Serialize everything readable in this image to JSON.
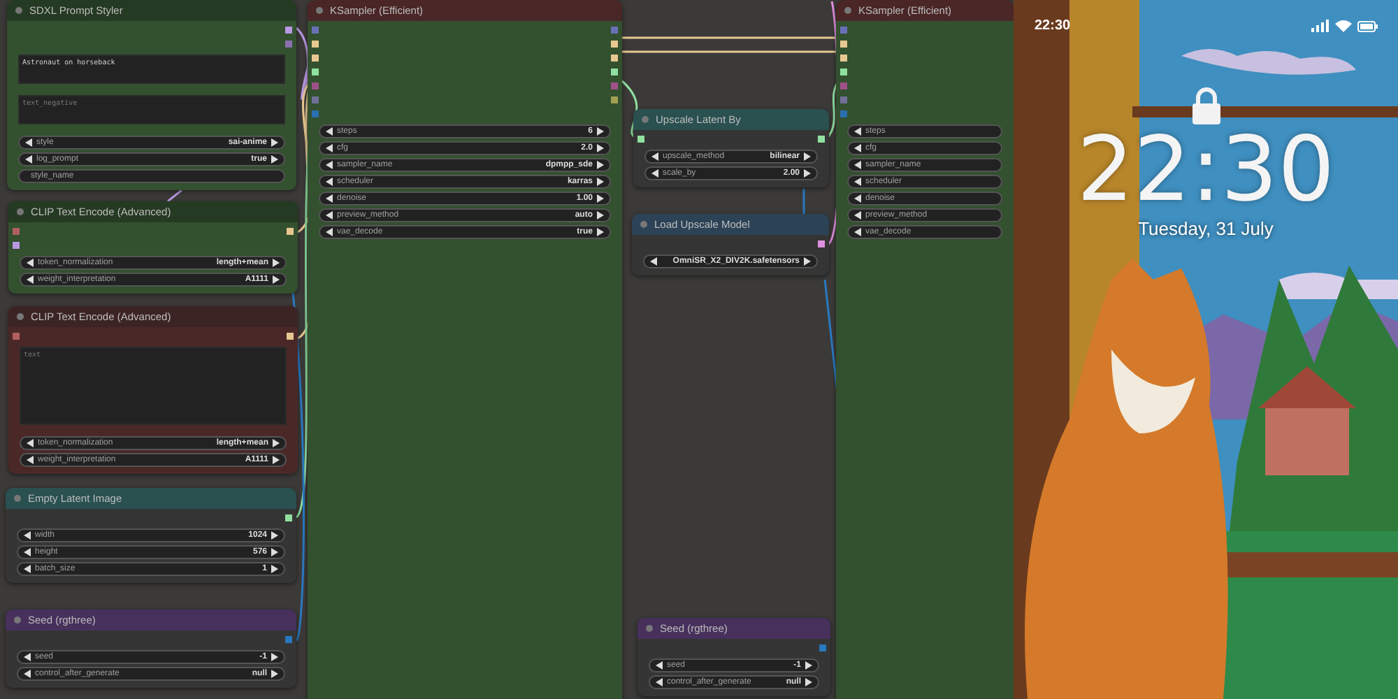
{
  "nodes": [
    {
      "title": "SDXL Prompt Styler",
      "color": "#253a22",
      "kind": "green",
      "outputs": [
        {
          "color": "#b898e0"
        },
        {
          "color": "#8a70b0"
        }
      ],
      "textareas": [
        {
          "value": "Astronaut on horseback"
        },
        {
          "placeholder": "text_negative"
        }
      ],
      "widgets": [
        {
          "kind": "combo",
          "label": "style",
          "value": "sai-anime"
        },
        {
          "kind": "combo",
          "label": "log_prompt",
          "value": "true"
        },
        {
          "kind": "text",
          "label": "style_name"
        }
      ]
    },
    {
      "title": "CLIP Text Encode (Advanced)",
      "color": "#253a22",
      "kind": "green",
      "inputs": [
        {
          "color": "#b06060"
        },
        {
          "color": "#b898e0"
        }
      ],
      "outputs": [
        {
          "color": "#e8c890"
        }
      ],
      "widgets": [
        {
          "kind": "combo",
          "label": "token_normalization",
          "value": "length+mean"
        },
        {
          "kind": "combo",
          "label": "weight_interpretation",
          "value": "A1111"
        }
      ]
    },
    {
      "title": "CLIP Text Encode (Advanced)",
      "color": "#3d2424",
      "kind": "red",
      "inputs": [
        {
          "color": "#b06060"
        }
      ],
      "outputs": [
        {
          "color": "#e8c890"
        }
      ],
      "textareas": [
        {
          "placeholder": "text"
        }
      ],
      "widgets": [
        {
          "kind": "combo",
          "label": "token_normalization",
          "value": "length+mean"
        },
        {
          "kind": "combo",
          "label": "weight_interpretation",
          "value": "A1111"
        }
      ]
    },
    {
      "title": "Empty Latent Image",
      "color": "#2a5050",
      "kind": "plain",
      "outputs": [
        {
          "color": "#90e0a0"
        }
      ],
      "widgets": [
        {
          "kind": "combo",
          "label": "width",
          "value": "1024"
        },
        {
          "kind": "combo",
          "label": "height",
          "value": "576"
        },
        {
          "kind": "combo",
          "label": "batch_size",
          "value": "1"
        }
      ]
    },
    {
      "title": "Seed (rgthree)",
      "color": "#47305c",
      "kind": "plain",
      "outputs": [
        {
          "color": "#2a78c0"
        }
      ],
      "widgets": [
        {
          "kind": "combo",
          "label": "seed",
          "value": "-1"
        },
        {
          "kind": "combo",
          "label": "control_after_generate",
          "value": "null"
        }
      ]
    },
    {
      "title": "KSampler (Efficient)",
      "color": "#4a2626",
      "kind": "green",
      "inputs": [
        {
          "color": "#6a70b8"
        },
        {
          "color": "#e8c890"
        },
        {
          "color": "#e8c891"
        },
        {
          "color": "#90e0a0"
        },
        {
          "color": "#a05088"
        },
        {
          "color": "#707098"
        },
        {
          "color": "#2a70b0"
        }
      ],
      "outputs": [
        {
          "color": "#6a70b8"
        },
        {
          "color": "#e8c890"
        },
        {
          "color": "#e8c891"
        },
        {
          "color": "#90e0a0"
        },
        {
          "color": "#a05088"
        },
        {
          "color": "#a0a050"
        }
      ],
      "widgets": [
        {
          "kind": "combo",
          "label": "steps",
          "value": "6"
        },
        {
          "kind": "combo",
          "label": "cfg",
          "value": "2.0"
        },
        {
          "kind": "combo",
          "label": "sampler_name",
          "value": "dpmpp_sde"
        },
        {
          "kind": "combo",
          "label": "scheduler",
          "value": "karras"
        },
        {
          "kind": "combo",
          "label": "denoise",
          "value": "1.00"
        },
        {
          "kind": "combo",
          "label": "preview_method",
          "value": "auto"
        },
        {
          "kind": "combo",
          "label": "vae_decode",
          "value": "true"
        }
      ]
    },
    {
      "title": "Upscale Latent By",
      "color": "#2a5050",
      "kind": "plain",
      "inputs": [
        {
          "color": "#90e0a0"
        }
      ],
      "outputs": [
        {
          "color": "#90e0a0"
        }
      ],
      "widgets": [
        {
          "kind": "combo",
          "label": "upscale_method",
          "value": "bilinear"
        },
        {
          "kind": "combo",
          "label": "scale_by",
          "value": "2.00"
        }
      ]
    },
    {
      "title": "Load Upscale Model",
      "color": "#2c4256",
      "kind": "plain",
      "outputs": [
        {
          "color": "#e090e0"
        }
      ],
      "widgets": [
        {
          "kind": "combo",
          "value": "OmniSR_X2_DIV2K.safetensors"
        }
      ]
    },
    {
      "title": "Seed (rgthree)",
      "color": "#47305c",
      "kind": "plain",
      "outputs": [
        {
          "color": "#2a78c0"
        }
      ],
      "widgets": [
        {
          "kind": "combo",
          "label": "seed",
          "value": "-1"
        },
        {
          "kind": "combo",
          "label": "control_after_generate",
          "value": "null"
        }
      ]
    },
    {
      "title": "KSampler (Efficient)",
      "color": "#4a2626",
      "kind": "green",
      "inputs": [
        {
          "color": "#6a70b8"
        },
        {
          "color": "#e8c890"
        },
        {
          "color": "#e8c891"
        },
        {
          "color": "#90e0a0"
        },
        {
          "color": "#a05088"
        },
        {
          "color": "#707098"
        },
        {
          "color": "#2a70b0"
        }
      ],
      "widgets": [
        {
          "kind": "combo",
          "label": "steps"
        },
        {
          "kind": "combo",
          "label": "cfg"
        },
        {
          "kind": "combo",
          "label": "sampler_name"
        },
        {
          "kind": "combo",
          "label": "scheduler"
        },
        {
          "kind": "combo",
          "label": "denoise"
        },
        {
          "kind": "combo",
          "label": "preview_method"
        },
        {
          "kind": "combo",
          "label": "vae_decode"
        }
      ]
    }
  ],
  "phone": {
    "status_time": "22:30",
    "clock": "22:30",
    "date": "Tuesday, 31 July"
  }
}
